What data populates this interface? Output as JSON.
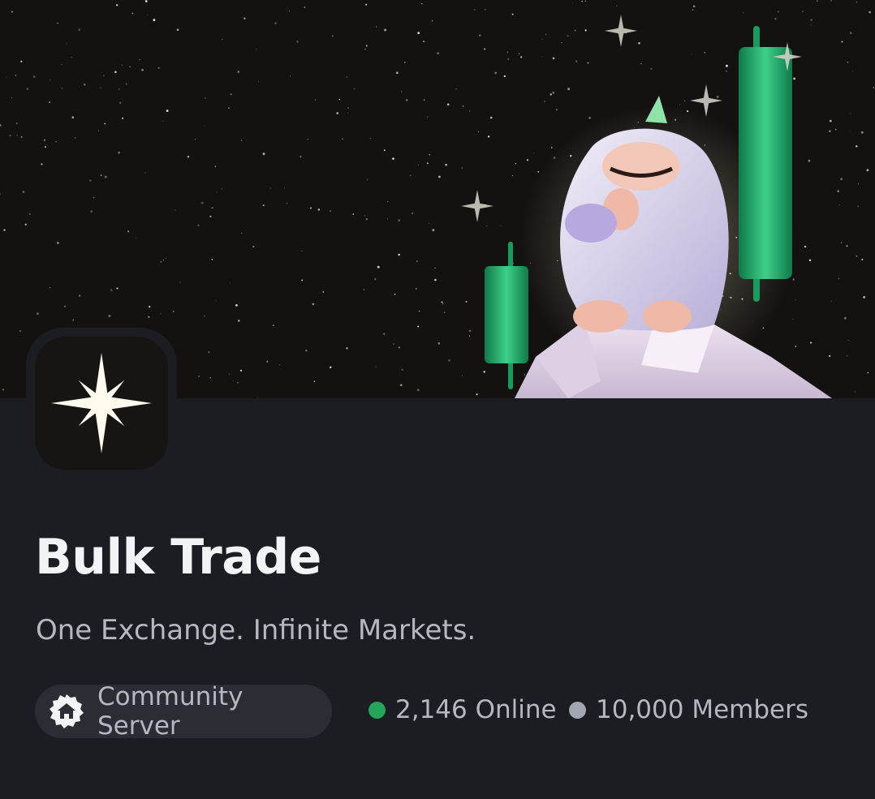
{
  "server": {
    "name": "Bulk Trade",
    "tagline": "One Exchange. Infinite Markets.",
    "badge_label": "Community Server",
    "online_text": "2,146 Online",
    "members_text": "10,000 Members"
  },
  "colors": {
    "page_background": "#1c1d23",
    "banner_background": "#131211",
    "online_dot": "#23a55a",
    "members_dot": "#a2a6b0",
    "candle_green": "#1fa66a"
  },
  "icons": {
    "server": "four-point-star-icon",
    "badge": "community-home-icon"
  }
}
